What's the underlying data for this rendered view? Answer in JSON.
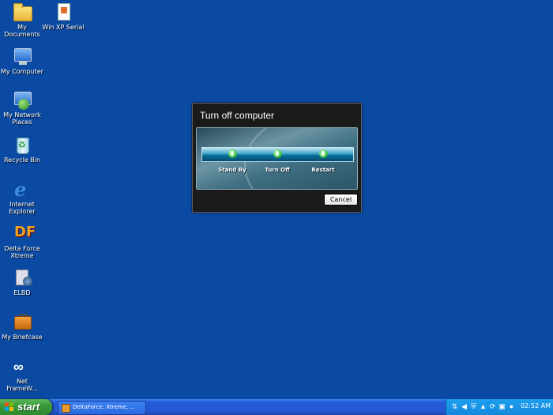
{
  "desktop": {
    "icons": [
      {
        "label": "My Documents",
        "icon": "folder-icon"
      },
      {
        "label": "Win XP Serial",
        "icon": "document-icon"
      },
      {
        "label": "My Computer",
        "icon": "computer-icon"
      },
      {
        "label": "My Network Places",
        "icon": "network-icon"
      },
      {
        "label": "Recycle Bin",
        "icon": "recycle-bin-icon"
      },
      {
        "label": "Internet Explorer",
        "icon": "ie-icon"
      },
      {
        "label": "Delta Force Xtreme",
        "icon": "delta-force-icon"
      },
      {
        "label": "ELBD",
        "icon": "elbd-icon"
      },
      {
        "label": "My Briefcase",
        "icon": "briefcase-icon"
      },
      {
        "label": "Net FrameW...",
        "icon": "net-framework-icon"
      }
    ]
  },
  "dialog": {
    "title": "Turn off computer",
    "options": [
      {
        "label": "Stand By",
        "icon": "standby-arrow-icon"
      },
      {
        "label": "Turn Off",
        "icon": "turnoff-arrow-icon"
      },
      {
        "label": "Restart",
        "icon": "restart-arrow-icon"
      }
    ],
    "cancel_label": "Cancel"
  },
  "taskbar": {
    "start_label": "start",
    "task_label": "DeltaForce: Xtreme, ...",
    "clock": "02:52 AM"
  },
  "colors": {
    "desktop": "#0b4aa3",
    "taskbar": "#245edb",
    "start": "#3a9a3a",
    "tray": "#1488dc"
  }
}
